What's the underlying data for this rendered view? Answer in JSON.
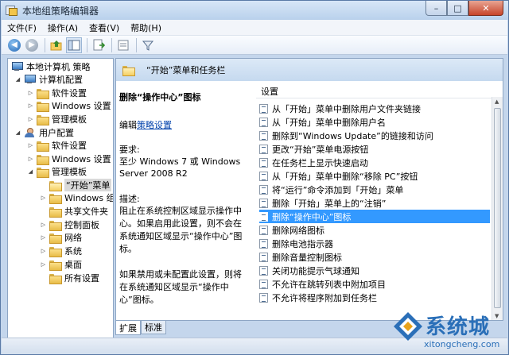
{
  "window": {
    "title": "本地组策略编辑器",
    "minimize_glyph": "–",
    "maximize_glyph": "□",
    "close_glyph": "✕"
  },
  "menu": {
    "items": [
      "文件(F)",
      "操作(A)",
      "查看(V)",
      "帮助(H)"
    ]
  },
  "toolbar": {
    "back_glyph": "◀",
    "forward_glyph": "▶",
    "filter_glyph": "⊽"
  },
  "tree": {
    "items": [
      {
        "label": "本地计算机 策略",
        "icon": "computer-icon"
      },
      {
        "label": "计算机配置",
        "icon": "computer-icon"
      },
      {
        "label": "软件设置",
        "icon": "folder-icon"
      },
      {
        "label": "Windows 设置",
        "icon": "folder-icon"
      },
      {
        "label": "管理模板",
        "icon": "folder-icon"
      },
      {
        "label": "用户配置",
        "icon": "user-icon"
      },
      {
        "label": "软件设置",
        "icon": "folder-icon"
      },
      {
        "label": "Windows 设置",
        "icon": "folder-icon"
      },
      {
        "label": "管理模板",
        "icon": "folder-icon"
      },
      {
        "label": "“开始”菜单",
        "icon": "folder-open-icon"
      },
      {
        "label": "Windows 组",
        "icon": "folder-icon"
      },
      {
        "label": "共享文件夹",
        "icon": "folder-icon"
      },
      {
        "label": "控制面板",
        "icon": "folder-icon"
      },
      {
        "label": "网络",
        "icon": "folder-icon"
      },
      {
        "label": "系统",
        "icon": "folder-icon"
      },
      {
        "label": "桌面",
        "icon": "folder-icon"
      },
      {
        "label": "所有设置",
        "icon": "folder-icon"
      }
    ]
  },
  "header": {
    "title": "“开始”菜单和任务栏"
  },
  "description": {
    "policy_title": "删除“操作中心”图标",
    "edit_prefix": "编辑",
    "edit_link": "策略设置",
    "requirements_label": "要求:",
    "requirements_text": "至少 Windows 7 或 Windows Server 2008 R2",
    "description_label": "描述:",
    "description_text": "阻止在系统控制区域显示操作中心。如果启用此设置，则不会在系统通知区域显示“操作中心”图标。\n\n如果禁用或未配置此设置，则将在系统通知区域显示“操作中心”图标。"
  },
  "settings": {
    "column_header": "设置",
    "items": [
      "从「开始」菜单中删除用户文件夹链接",
      "从「开始」菜单中删除用户名",
      "删除到“Windows Update”的链接和访问",
      "更改“开始”菜单电源按钮",
      "在任务栏上显示快速启动",
      "从「开始」菜单中删除“移除 PC”按钮",
      "将“运行”命令添加到「开始」菜单",
      "删除「开始」菜单上的“注销”",
      "删除“操作中心”图标",
      "删除网络图标",
      "删除电池指示器",
      "删除音量控制图标",
      "关闭功能提示气球通知",
      "不允许在跳转列表中附加项目",
      "不允许将程序附加到任务栏"
    ],
    "selected_index": 8
  },
  "tabs": [
    "扩展",
    "标准"
  ],
  "watermark": {
    "brand": "系统城",
    "url": "xitongcheng.com"
  }
}
